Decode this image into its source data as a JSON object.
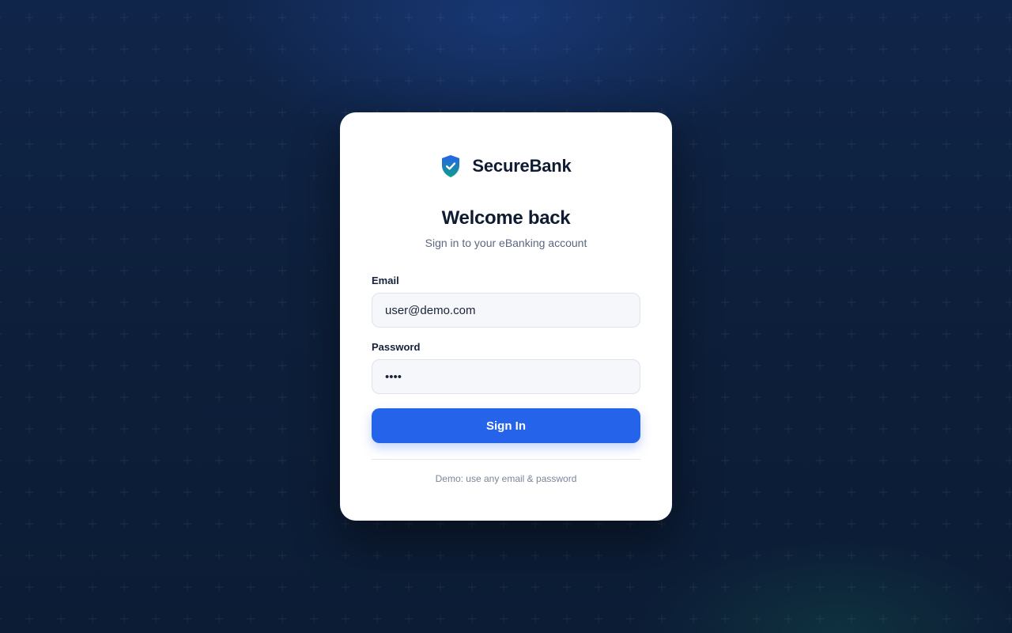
{
  "brand": {
    "name": "SecureBank",
    "icon": "shield-check-icon",
    "icon_color_top": "#2563eb",
    "icon_color_bottom": "#0f9d8a"
  },
  "header": {
    "title": "Welcome back",
    "subtitle": "Sign in to your eBanking account"
  },
  "form": {
    "email_label": "Email",
    "email_value": "user@demo.com",
    "password_label": "Password",
    "password_value": "demo",
    "submit_label": "Sign In"
  },
  "footer": {
    "hint": "Demo: use any email & password"
  },
  "colors": {
    "accent": "#2563eb",
    "background": "#0e1f3a",
    "card": "#ffffff"
  }
}
